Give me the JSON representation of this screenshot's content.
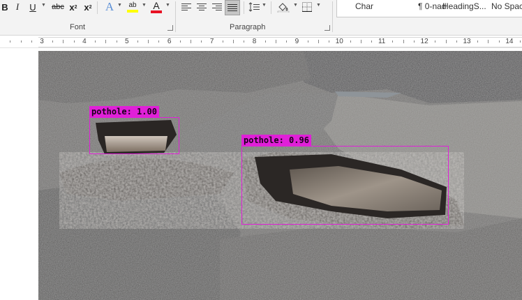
{
  "ribbon": {
    "font_buttons": {
      "bold": "B",
      "italic": "I",
      "underline": "U",
      "strikethrough": "abc",
      "subscript": "x",
      "subscript_mark": "2",
      "superscript": "x",
      "superscript_mark": "2",
      "text_effects": "A",
      "highlight": "ab",
      "font_color": "A"
    },
    "font_group_label": "Font",
    "paragraph_group_label": "Paragraph",
    "styles": [
      "Char",
      "¶ 0-nad",
      "HeadingS...",
      "No Spac"
    ],
    "colors": {
      "highlight_bar": "#ffff00",
      "font_color_bar": "#e81123",
      "active_button_bg": "#c5c5c5"
    }
  },
  "ruler": {
    "numbers": [
      "3",
      "4",
      "5",
      "6",
      "7",
      "8",
      "9",
      "10",
      "11",
      "12",
      "13",
      "14"
    ]
  },
  "detections": [
    {
      "label": "pothole: 1.00"
    },
    {
      "label": "pothole: 0.96"
    }
  ],
  "colors": {
    "bbox": "#e020d8"
  }
}
